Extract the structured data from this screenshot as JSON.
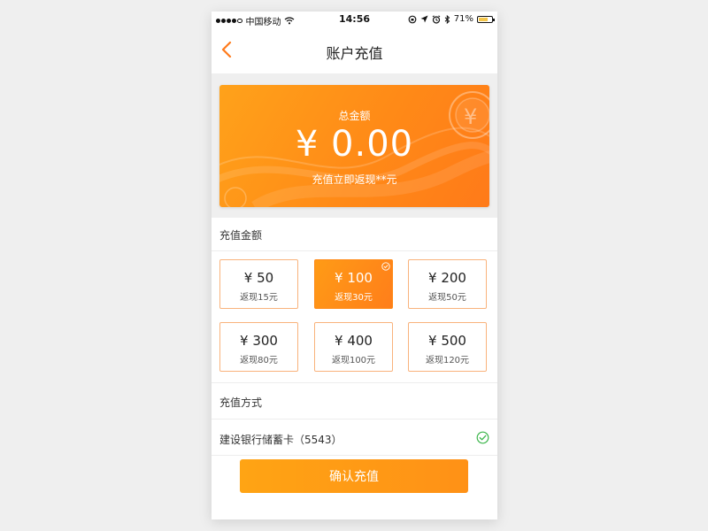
{
  "status_bar": {
    "carrier": "中国移动",
    "time": "14:56",
    "battery": "71%",
    "battery_level": 0.71
  },
  "nav": {
    "title": "账户充值"
  },
  "balance_card": {
    "label": "总金额",
    "amount": "¥ 0.00",
    "subtitle": "充值立即返现**元"
  },
  "recharge": {
    "section_title": "充值金额",
    "options": [
      {
        "amount": "¥ 50",
        "rebate": "返现15元",
        "selected": false
      },
      {
        "amount": "¥ 100",
        "rebate": "返现30元",
        "selected": true
      },
      {
        "amount": "¥ 200",
        "rebate": "返现50元",
        "selected": false
      },
      {
        "amount": "¥ 300",
        "rebate": "返现80元",
        "selected": false
      },
      {
        "amount": "¥ 400",
        "rebate": "返现100元",
        "selected": false
      },
      {
        "amount": "¥ 500",
        "rebate": "返现120元",
        "selected": false
      }
    ]
  },
  "payment": {
    "section_title": "充值方式",
    "method": "建设银行储蓄卡（5543）"
  },
  "confirm_label": "确认充值",
  "colors": {
    "accent": "#ff8a17",
    "success": "#3bb54a"
  }
}
